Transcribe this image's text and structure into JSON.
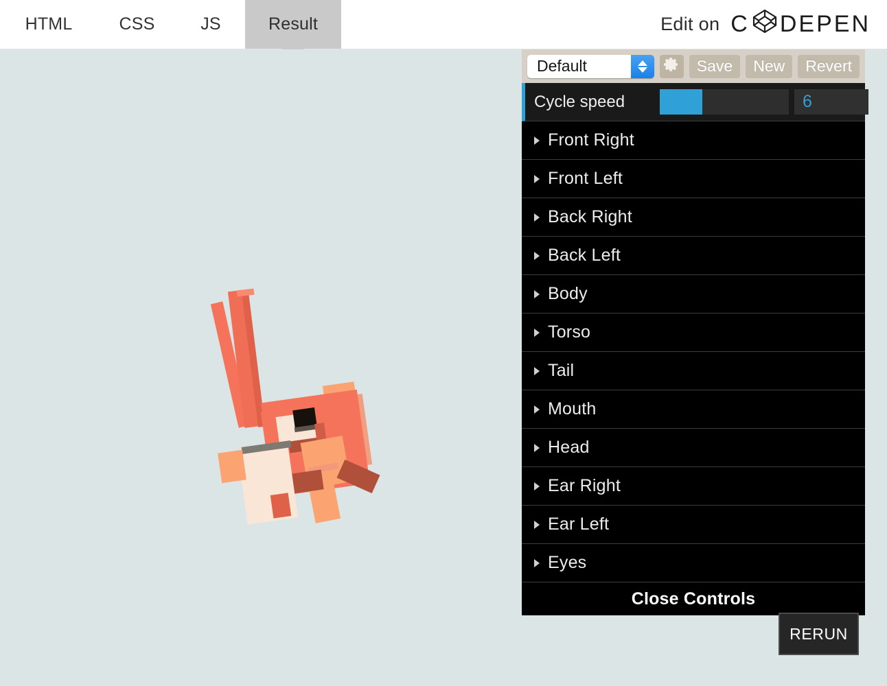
{
  "topbar": {
    "tabs": [
      {
        "label": "HTML",
        "active": false
      },
      {
        "label": "CSS",
        "active": false
      },
      {
        "label": "JS",
        "active": false
      },
      {
        "label": "Result",
        "active": true
      }
    ],
    "edit_on_label": "Edit on",
    "brand_c": "C",
    "brand_rest": "DEPEN",
    "brand_icon": "codepen-logo-icon"
  },
  "gui": {
    "preset": {
      "selected": "Default",
      "options": [
        "Default"
      ],
      "gear_icon": "gear-icon",
      "save_label": "Save",
      "new_label": "New",
      "revert_label": "Revert"
    },
    "slider": {
      "label": "Cycle speed",
      "value": "6",
      "fill_percent": 33,
      "accent_color": "#2fa1d6"
    },
    "folders": [
      {
        "label": "Front Right"
      },
      {
        "label": "Front Left"
      },
      {
        "label": "Back Right"
      },
      {
        "label": "Back Left"
      },
      {
        "label": "Body"
      },
      {
        "label": "Torso"
      },
      {
        "label": "Tail"
      },
      {
        "label": "Mouth"
      },
      {
        "label": "Head"
      },
      {
        "label": "Ear Right"
      },
      {
        "label": "Ear Left"
      },
      {
        "label": "Eyes"
      }
    ],
    "close_label": "Close Controls"
  },
  "result": {
    "background_color": "#dbe5e5",
    "rerun_label": "RERUN",
    "figure_name": "voxel-fox-character",
    "palette": {
      "orange_mid": "#f4735a",
      "orange_dark": "#e05b45",
      "orange_light": "#fba472",
      "cream": "#fae6d6",
      "brown": "#b1503a",
      "black": "#1a1410"
    }
  }
}
